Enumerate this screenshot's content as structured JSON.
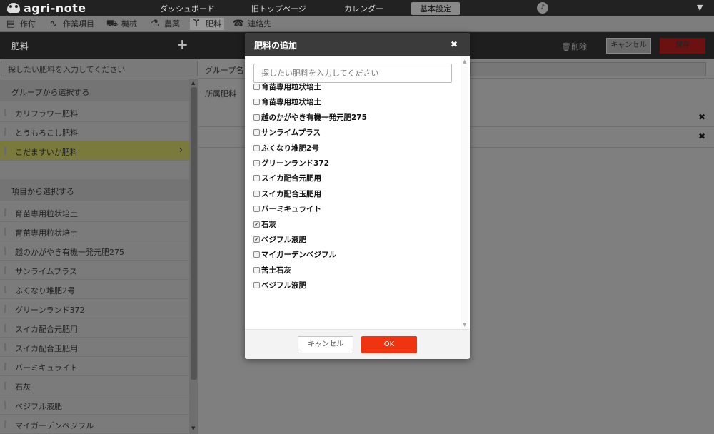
{
  "brand": {
    "name": "agri-note"
  },
  "topnav": {
    "dashboard": "ダッシュボード",
    "old_top": "旧トップページ",
    "calendar": "カレンダー",
    "basic_settings": "基本設定"
  },
  "subnav": [
    {
      "label": "作付",
      "icon": "document-icon"
    },
    {
      "label": "作業項目",
      "icon": "hoe-icon"
    },
    {
      "label": "機械",
      "icon": "tractor-icon"
    },
    {
      "label": "農薬",
      "icon": "flask-icon"
    },
    {
      "label": "肥料",
      "icon": "sprout-icon"
    },
    {
      "label": "連絡先",
      "icon": "contact-book-icon"
    }
  ],
  "panel": {
    "title": "肥料",
    "delete_label": "削除",
    "cancel_label": "キャンセル",
    "save_label": "保存"
  },
  "left": {
    "search_placeholder": "探したい肥料を入力してください",
    "group_section": "グループから選択する",
    "groups": [
      "カリフラワー肥料",
      "とうもろこし肥料",
      "こだますいか肥料"
    ],
    "item_section": "項目から選択する",
    "items": [
      "育苗専用粒状培土",
      "育苗専用粒状培土",
      "越のかがやき有機一発元肥275",
      "サンライムプラス",
      "ふくなり堆肥2号",
      "グリーンランド372",
      "スイカ配合元肥用",
      "スイカ配合玉肥用",
      "バーミキュライト",
      "石灰",
      "ベジフル液肥",
      "マイガーデンベジフル"
    ]
  },
  "right": {
    "group_label": "グループ名",
    "belong_label": "所属肥料"
  },
  "modal": {
    "title": "肥料の追加",
    "search_placeholder": "探したい肥料を入力してください",
    "options": [
      {
        "label": "育苗専用粒状培土",
        "checked": false
      },
      {
        "label": "育苗専用粒状培土",
        "checked": false
      },
      {
        "label": "越のかがやき有機一発元肥275",
        "checked": false
      },
      {
        "label": "サンライムプラス",
        "checked": false
      },
      {
        "label": "ふくなり堆肥2号",
        "checked": false
      },
      {
        "label": "グリーンランド372",
        "checked": false
      },
      {
        "label": "スイカ配合元肥用",
        "checked": false
      },
      {
        "label": "スイカ配合玉肥用",
        "checked": false
      },
      {
        "label": "バーミキュライト",
        "checked": false
      },
      {
        "label": "石灰",
        "checked": true
      },
      {
        "label": "ベジフル液肥",
        "checked": true
      },
      {
        "label": "マイガーデンベジフル",
        "checked": false
      },
      {
        "label": "苦土石灰",
        "checked": false
      },
      {
        "label": "ベジフル液肥",
        "checked": false
      }
    ],
    "cancel_label": "キャンセル",
    "ok_label": "OK"
  }
}
